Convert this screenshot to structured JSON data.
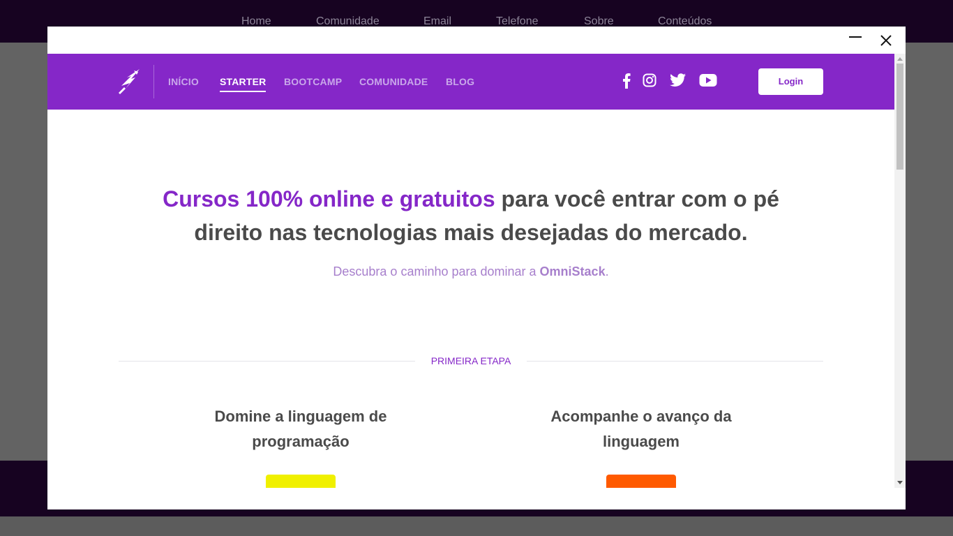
{
  "background_page": {
    "nav": [
      "Home",
      "Comunidade",
      "Email",
      "Telefone",
      "Sobre",
      "Conteúdos"
    ]
  },
  "modal": {
    "controls": {
      "minimize": "minimize",
      "close": "close"
    }
  },
  "site": {
    "nav": [
      {
        "label": "INÍCIO",
        "active": false
      },
      {
        "label": "STARTER",
        "active": true
      },
      {
        "label": "BOOTCAMP",
        "active": false
      },
      {
        "label": "COMUNIDADE",
        "active": false
      },
      {
        "label": "BLOG",
        "active": false
      }
    ],
    "social_icons": [
      "facebook-icon",
      "instagram-icon",
      "twitter-icon",
      "youtube-icon"
    ],
    "login_label": "Login",
    "hero": {
      "highlight": "Cursos 100% online e gratuitos",
      "title_rest": " para você entrar com o pé direito nas tecnologias mais desejadas do mercado.",
      "sub_prefix": "Descubra o caminho para dominar a ",
      "sub_brand": "OmniStack",
      "sub_suffix": "."
    },
    "stage_label": "PRIMEIRA ETAPA",
    "cards": [
      {
        "title": "Domine a linguagem de programação",
        "badge_color": "#f0f000"
      },
      {
        "title": "Acompanhe o avanço da linguagem",
        "badge_color": "#ff5a00"
      }
    ]
  },
  "colors": {
    "brand_purple": "#8527c8",
    "dark_bar": "#170321"
  }
}
